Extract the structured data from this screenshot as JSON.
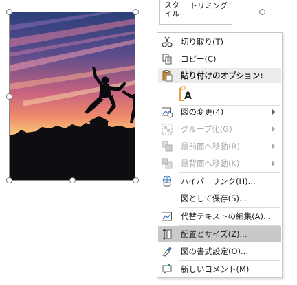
{
  "mini_toolbar": {
    "style_label": "スタイル",
    "trim_label": "トリミング"
  },
  "context_menu": {
    "cut": "切り取り(T)",
    "copy": "コピー(C)",
    "paste_options_header": "貼り付けのオプション:",
    "paste_option_icon_letter": "A",
    "change_picture": "図の変更(4)",
    "group": "グループ化(G)",
    "bring_to_front": "最前面へ移動(R)",
    "send_to_back": "最背面へ移動(K)",
    "hyperlink": "ハイパーリンク(H)...",
    "save_as_picture": "図として保存(S)...",
    "edit_alt_text": "代替テキストの編集(A)...",
    "size_and_position": "配置とサイズ(Z)...",
    "format_picture": "図の書式設定(O)...",
    "new_comment": "新しいコメント(M)"
  },
  "colors": {
    "menu_highlight": "#c9c9c9",
    "menu_header_bg": "#ececec",
    "paste_icon_orange": "#e8a23a"
  }
}
